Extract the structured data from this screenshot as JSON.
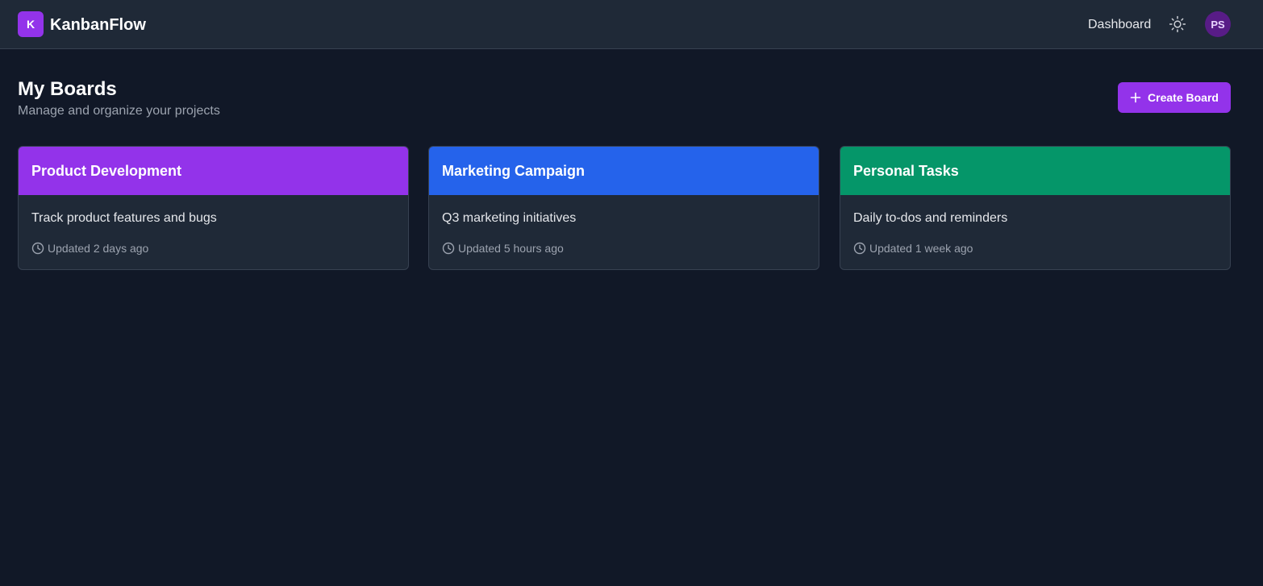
{
  "app": {
    "logo_letter": "K",
    "name": "KanbanFlow"
  },
  "nav": {
    "dashboard_label": "Dashboard",
    "theme_icon": "sun-icon",
    "avatar_initials": "PS"
  },
  "header": {
    "title": "My Boards",
    "subtitle": "Manage and organize your projects",
    "create_button_label": "Create Board",
    "create_button_icon": "plus-icon"
  },
  "colors": {
    "accent": "#9333ea",
    "background": "#111827",
    "surface": "#1f2937"
  },
  "boards": [
    {
      "title": "Product Development",
      "description": "Track product features and bugs",
      "updated": "Updated 2 days ago",
      "color": "#9333ea"
    },
    {
      "title": "Marketing Campaign",
      "description": "Q3 marketing initiatives",
      "updated": "Updated 5 hours ago",
      "color": "#2563eb"
    },
    {
      "title": "Personal Tasks",
      "description": "Daily to-dos and reminders",
      "updated": "Updated 1 week ago",
      "color": "#059669"
    }
  ]
}
